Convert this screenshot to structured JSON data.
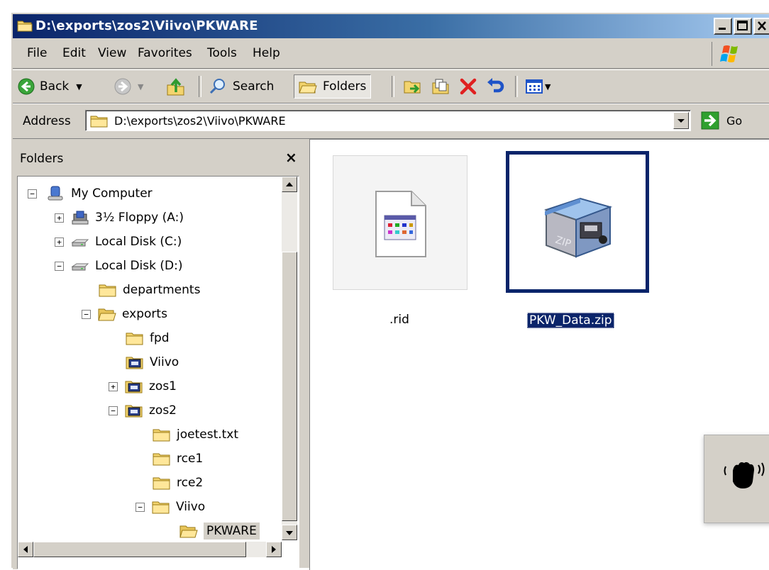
{
  "window": {
    "title": "D:\\exports\\zos2\\Viivo\\PKWARE"
  },
  "menu": {
    "items": [
      "File",
      "Edit",
      "View",
      "Favorites",
      "Tools",
      "Help"
    ]
  },
  "toolbar": {
    "back_label": "Back",
    "search_label": "Search",
    "folders_label": "Folders"
  },
  "address": {
    "label": "Address",
    "value": "D:\\exports\\zos2\\Viivo\\PKWARE",
    "go_label": "Go"
  },
  "folders_pane": {
    "title": "Folders",
    "close_glyph": "×",
    "tree": [
      {
        "label": "My Computer",
        "expander": "−",
        "icon": "computer-icon"
      },
      {
        "label": "3½ Floppy (A:)",
        "expander": "+",
        "icon": "floppy-icon"
      },
      {
        "label": "Local Disk (C:)",
        "expander": "+",
        "icon": "disk-icon"
      },
      {
        "label": "Local Disk (D:)",
        "expander": "−",
        "icon": "disk-icon"
      },
      {
        "label": "departments",
        "expander": "",
        "icon": "folder-icon"
      },
      {
        "label": "exports",
        "expander": "−",
        "icon": "folder-open-icon"
      },
      {
        "label": "fpd",
        "expander": "",
        "icon": "folder-icon"
      },
      {
        "label": "Viivo",
        "expander": "",
        "icon": "viivo-folder-icon"
      },
      {
        "label": "zos1",
        "expander": "+",
        "icon": "viivo-folder-icon"
      },
      {
        "label": "zos2",
        "expander": "−",
        "icon": "viivo-folder-icon"
      },
      {
        "label": "joetest.txt",
        "expander": "",
        "icon": "folder-icon"
      },
      {
        "label": "rce1",
        "expander": "",
        "icon": "folder-icon"
      },
      {
        "label": "rce2",
        "expander": "",
        "icon": "folder-icon"
      },
      {
        "label": "Viivo",
        "expander": "−",
        "icon": "folder-icon"
      },
      {
        "label": "PKWARE",
        "expander": "",
        "icon": "folder-open-icon",
        "selected": true
      }
    ]
  },
  "files": [
    {
      "name": ".rid",
      "icon": "document-icon",
      "selected": false
    },
    {
      "name": "PKW_Data.zip",
      "icon": "zip-archive-icon",
      "selected": true
    }
  ],
  "colors": {
    "title_gradient_start": "#0a246a",
    "selection": "#0a246a",
    "chrome": "#d4d0c8"
  }
}
